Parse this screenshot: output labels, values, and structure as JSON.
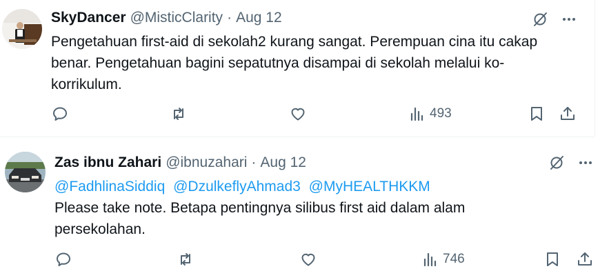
{
  "tweets": [
    {
      "user": {
        "name": "SkyDancer",
        "handle": "@MisticClarity"
      },
      "separator": "·",
      "date": "Aug 12",
      "body_lines": [
        "Pengetahuan first-aid di sekolah2 kurang sangat. Perempuan cina itu cakap",
        "benar.  Pengetahuan bagini sepatutnya disampai di sekolah melalui ko-",
        "korrikulum."
      ],
      "stats": {
        "views": "493"
      }
    },
    {
      "user": {
        "name": "Zas ibnu Zahari",
        "handle": "@ibnuzahari"
      },
      "separator": "·",
      "date": "Aug 12",
      "mentions": [
        "@FadhlinaSiddiq",
        "@DzulkeflyAhmad3",
        "@MyHEALTHKKM"
      ],
      "body_lines": [
        "Please take note.  Betapa pentingnya silibus  first aid dalam alam",
        "persekolahan."
      ],
      "stats": {
        "views": "746"
      }
    }
  ],
  "icons": {
    "action_row": [
      "reply-icon",
      "repost-icon",
      "like-icon",
      "views-icon",
      "bookmark-icon",
      "share-icon"
    ],
    "top_right": [
      "grok-slash-icon",
      "more-icon"
    ]
  },
  "colors": {
    "text": "#0f1419",
    "secondary": "#536471",
    "link": "#1d9bf0",
    "divider": "#eff3f4"
  }
}
